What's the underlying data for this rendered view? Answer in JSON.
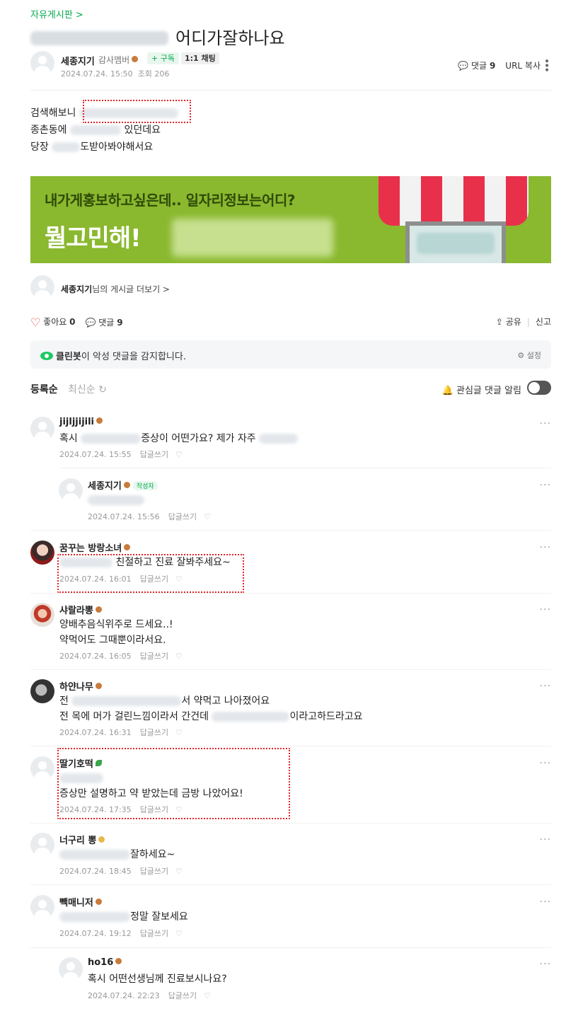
{
  "breadcrumb": "자유게시판 >",
  "post": {
    "title": "어디가잘하나요",
    "author": "세종지기",
    "rank": "감사멤버",
    "subscribe": "+ 구독",
    "chat": "1:1 채팅",
    "date": "2024.07.24. 15:50",
    "views": "조회 206",
    "comment_label": "댓글",
    "comment_count": "9",
    "url_copy": "URL 복사",
    "body": {
      "line1_prefix": "검색해보니",
      "line2_prefix": "종촌동에",
      "line2_suffix": "있던데요",
      "line3_prefix": "당장",
      "line3_suffix": "도받아봐야해서요"
    }
  },
  "banner": {
    "line1": "내가게홍보하고싶은데.. 일자리정보는어디?",
    "line2": "뭘고민해!"
  },
  "more_posts": {
    "author": "세종지기",
    "suffix": "님의 게시글 더보기 >"
  },
  "actions": {
    "like_label": "좋아요",
    "like_count": "0",
    "comment_label": "댓글",
    "comment_count": "9",
    "share": "공유",
    "report": "신고"
  },
  "cleanbot": {
    "name": "클린봇",
    "text": "이 악성 댓글을 감지합니다.",
    "settings": "설정"
  },
  "sort": {
    "registered": "등록순",
    "latest": "최신순",
    "alarm": "관심글 댓글 알림"
  },
  "comment_ui": {
    "reply": "답글쓰기",
    "author_tag": "작성자",
    "more": "···"
  },
  "comments": [
    {
      "name": "jijljjijili",
      "text_prefix": "혹시",
      "text_mid": "증상이 어떤가요? 제가 자주",
      "date": "2024.07.24. 15:55"
    },
    {
      "name": "세종지기",
      "date": "2024.07.24. 15:56"
    },
    {
      "name": "꿈꾸는 방랑소녀",
      "text_suffix": "친절하고 진료 잘봐주세요~",
      "date": "2024.07.24. 16:01"
    },
    {
      "name": "샤랄라뽕",
      "text_line1": "양배추음식위주로 드세요..!",
      "text_line2": "약먹어도 그때뿐이라서요.",
      "date": "2024.07.24. 16:05"
    },
    {
      "name": "하얀나무",
      "text_line1_prefix": "전",
      "text_line1_suffix": "서 약먹고 나아졌어요",
      "text_line2_prefix": "전 목에 머가 걸린느낌이라서 간건데",
      "text_line2_suffix": "이라고하드라고요",
      "date": "2024.07.24. 16:31"
    },
    {
      "name": "딸기호떡",
      "text_line2": "증상만 설명하고 약 받았는데 금방 나았어요!",
      "date": "2024.07.24. 17:35"
    },
    {
      "name": "너구리 뽕",
      "text_suffix": "잘하세요~",
      "date": "2024.07.24. 18:45"
    },
    {
      "name": "빽매니저",
      "text_suffix": "정말 잘보세요",
      "date": "2024.07.24. 19:12"
    },
    {
      "name": "ho16",
      "text": "혹시 어떤선생님께 진료보시나요?",
      "date": "2024.07.24. 22:23"
    }
  ],
  "colors": {
    "accent_green": "#03a94d",
    "banner_bg": "#8ab82f",
    "highlight_red": "#e0242a",
    "like_red": "#e03c3c"
  }
}
